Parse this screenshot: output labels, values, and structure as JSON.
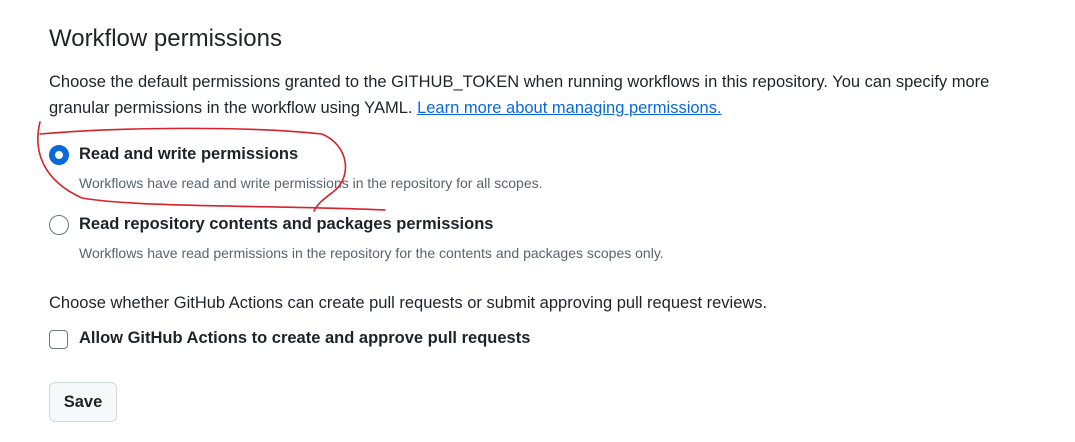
{
  "section": {
    "title": "Workflow permissions",
    "description": "Choose the default permissions granted to the GITHUB_TOKEN when running workflows in this repository. You can specify more granular permissions in the workflow using YAML.",
    "learn_more_link": "Learn more about managing permissions."
  },
  "options": [
    {
      "label": "Read and write permissions",
      "note": "Workflows have read and write permissions in the repository for all scopes.",
      "selected": true
    },
    {
      "label": "Read repository contents and packages permissions",
      "note": "Workflows have read permissions in the repository for the contents and packages scopes only.",
      "selected": false
    }
  ],
  "pull_requests": {
    "prompt": "Choose whether GitHub Actions can create pull requests or submit approving pull request reviews.",
    "checkbox_label": "Allow GitHub Actions to create and approve pull requests",
    "checked": false
  },
  "save_label": "Save",
  "colors": {
    "accent": "#0969da",
    "annotation": "#d6222b"
  }
}
